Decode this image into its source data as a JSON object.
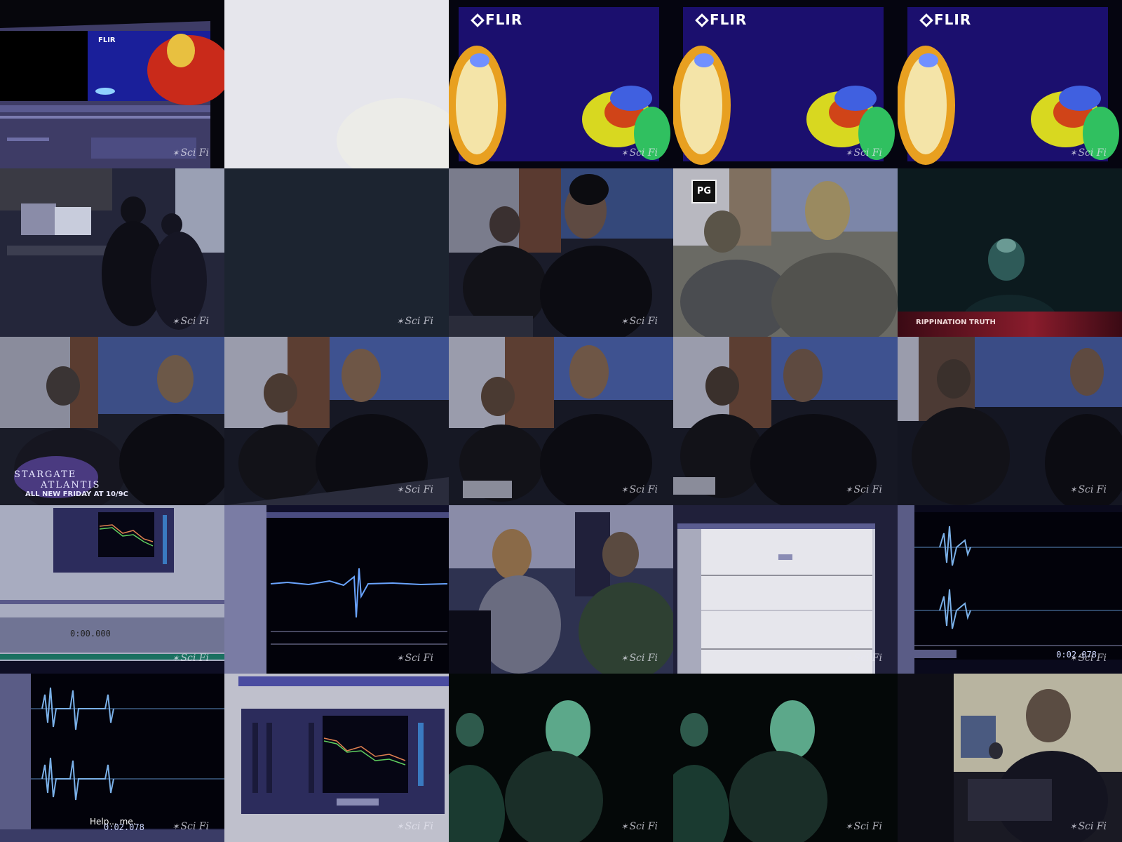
{
  "colors": {
    "thermal_bg": "#1b0f6e",
    "office_dark": "#1c2430",
    "nightvision": "#2a6a58",
    "scifi_bug": "#e6e6f0",
    "banner_red": "#8a1c2c"
  },
  "overlays": {
    "flir_label": "FLIR",
    "scifi_bug": "Sci Fi",
    "rating": "PG",
    "banner_text": "RIPPINATION TRUTH",
    "promo_line1": "STARGATE",
    "promo_line2": "ATLANTIS",
    "promo_line3": "ALL NEW FRIDAY AT 10/9C",
    "caption": "Help... me.",
    "timecode": "0:02.078"
  },
  "tiles": [
    {
      "subject": "thermal-monitor"
    },
    {
      "subject": "washed-out-frame"
    },
    {
      "subject": "thermal-two-faces"
    },
    {
      "subject": "thermal-two-faces"
    },
    {
      "subject": "thermal-two-faces"
    },
    {
      "subject": "office-computers"
    },
    {
      "subject": "dark-frame"
    },
    {
      "subject": "two-men-watching"
    },
    {
      "subject": "two-men-watching-faded"
    },
    {
      "subject": "nightvision-figure"
    },
    {
      "subject": "two-men-promo"
    },
    {
      "subject": "two-men-table"
    },
    {
      "subject": "two-men-table"
    },
    {
      "subject": "two-men-table"
    },
    {
      "subject": "two-men-table"
    },
    {
      "subject": "audio-plugin-screen"
    },
    {
      "subject": "waveform-spike"
    },
    {
      "subject": "two-men-lab"
    },
    {
      "subject": "flat-waveform-window"
    },
    {
      "subject": "waveform-bursts"
    },
    {
      "subject": "waveform-bursts-caption"
    },
    {
      "subject": "directx-plugin-screen"
    },
    {
      "subject": "nightvision-faces"
    },
    {
      "subject": "nightvision-faces"
    },
    {
      "subject": "man-at-desk"
    }
  ]
}
